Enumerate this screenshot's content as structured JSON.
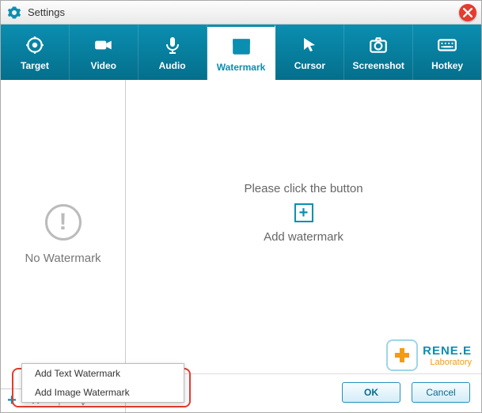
{
  "window": {
    "title": "Settings"
  },
  "tabs": [
    {
      "label": "Target"
    },
    {
      "label": "Video"
    },
    {
      "label": "Audio"
    },
    {
      "label": "Watermark"
    },
    {
      "label": "Cursor"
    },
    {
      "label": "Screenshot"
    },
    {
      "label": "Hotkey"
    }
  ],
  "selected_tab_index": 3,
  "sidebar": {
    "preview_label": "No Watermark",
    "actions": {
      "add": "+",
      "remove": "×",
      "up": "↑",
      "down": "↓"
    }
  },
  "main": {
    "hint_line1": "Please click  the button",
    "hint_line2": "Add watermark",
    "plus": "+"
  },
  "popup": {
    "items": [
      "Add Text Watermark",
      "Add Image Watermark"
    ]
  },
  "buttons": {
    "ok": "OK",
    "cancel": "Cancel"
  },
  "brand": {
    "line1": "RENE.E",
    "line2": "Laboratory"
  }
}
